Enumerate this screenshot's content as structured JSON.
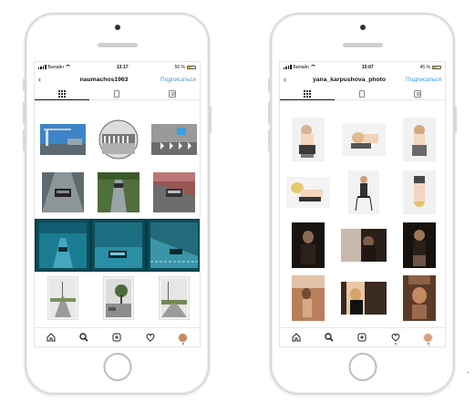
{
  "phones": [
    {
      "status": {
        "carrier": "Билайн",
        "time": "13:17",
        "battery": "50 %",
        "battery_level": 0.5
      },
      "header": {
        "back": "‹",
        "username": "naumachos1963",
        "action": "Подписаться"
      },
      "tabs": [
        "grid-icon",
        "feed-icon",
        "tagged-icon"
      ],
      "tabbar": [
        "home-icon",
        "search-icon",
        "add-icon",
        "heart-icon",
        "profile-avatar"
      ],
      "colors": {
        "accent": "#3897f0"
      }
    },
    {
      "status": {
        "carrier": "Билайн",
        "time": "10:07",
        "battery": "45 %",
        "battery_level": 0.45
      },
      "header": {
        "back": "‹",
        "username": "yana_karpushova_photo",
        "action": "Подписаться"
      },
      "tabs": [
        "grid-icon",
        "feed-icon",
        "tagged-icon"
      ],
      "tabbar": [
        "home-icon",
        "search-icon",
        "add-icon",
        "heart-icon",
        "profile-avatar"
      ],
      "colors": {
        "accent": "#3897f0"
      }
    }
  ]
}
